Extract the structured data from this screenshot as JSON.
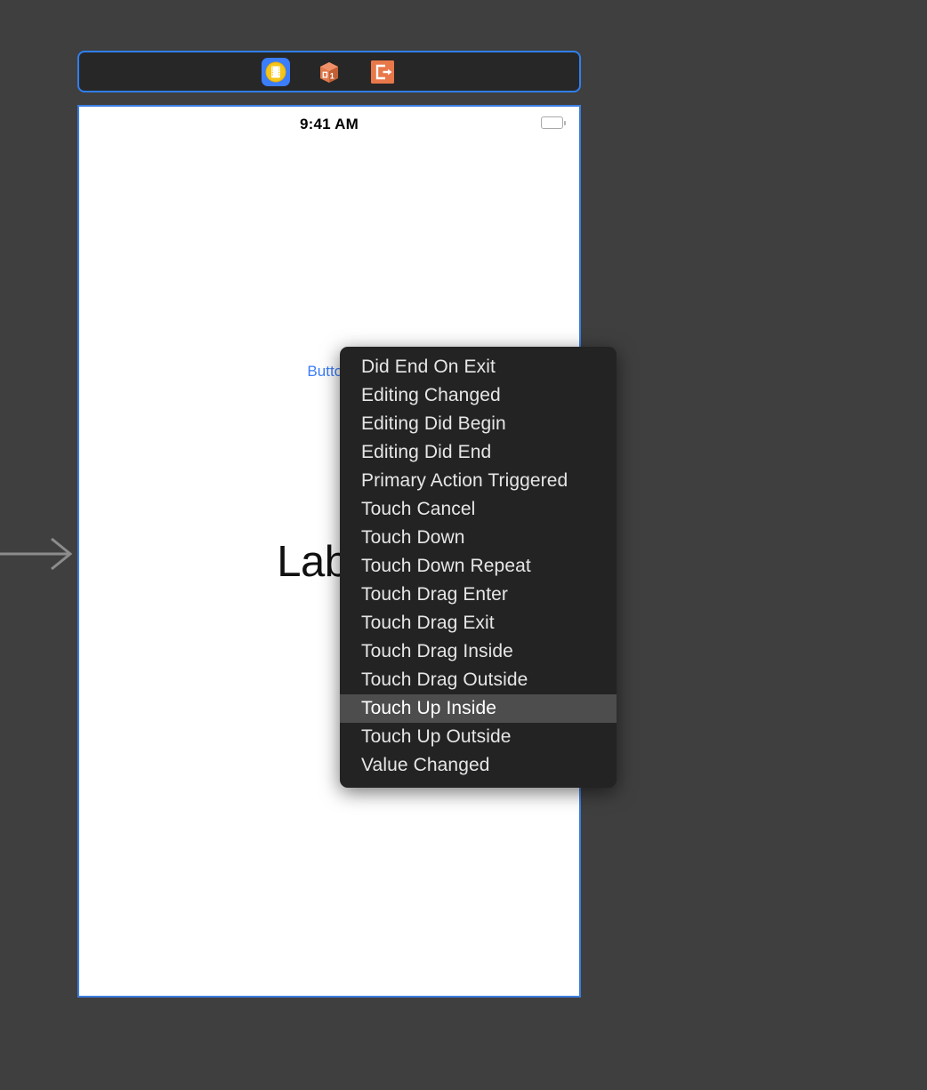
{
  "canvas_background_color": "#3f3f3f",
  "scene_dock": {
    "name": "scene-dock",
    "selected": true,
    "border_color": "#2f7ff0",
    "background_color": "#272727",
    "icons": [
      {
        "name": "view-controller-icon",
        "label": "View Controller",
        "selected": true,
        "colors": {
          "badge": "#3c7dfa",
          "inner": "#f5c518",
          "glyph": "#ffffff"
        }
      },
      {
        "name": "first-responder-icon",
        "label": "First Responder",
        "selected": false,
        "colors": {
          "cube": "#e8784a",
          "glyph": "#ffffff"
        }
      },
      {
        "name": "exit-icon",
        "label": "Exit",
        "selected": false,
        "colors": {
          "badge": "#e8784a",
          "glyph": "#ffffff"
        }
      }
    ]
  },
  "device": {
    "name": "device-canvas",
    "border_color": "#3b7de0",
    "background_color": "#ffffff",
    "status_bar": {
      "time": "9:41 AM",
      "battery_icon": "battery-full-icon"
    },
    "views": [
      {
        "name": "button",
        "text": "Button",
        "color": "#3c7dfa"
      },
      {
        "name": "label",
        "text": "Label",
        "color": "#111111"
      }
    ]
  },
  "connection_arrow": {
    "name": "connection-drag-arrow",
    "direction": "right",
    "color": "#8c8c8c"
  },
  "events_menu": {
    "name": "events-context-menu",
    "background_color": "#232323",
    "text_color": "#e6e6e6",
    "highlight_color": "#4d4d4d",
    "selected_index": 12,
    "items": [
      {
        "label": "Did End On Exit",
        "selected": false
      },
      {
        "label": "Editing Changed",
        "selected": false
      },
      {
        "label": "Editing Did Begin",
        "selected": false
      },
      {
        "label": "Editing Did End",
        "selected": false
      },
      {
        "label": "Primary Action Triggered",
        "selected": false
      },
      {
        "label": "Touch Cancel",
        "selected": false
      },
      {
        "label": "Touch Down",
        "selected": false
      },
      {
        "label": "Touch Down Repeat",
        "selected": false
      },
      {
        "label": "Touch Drag Enter",
        "selected": false
      },
      {
        "label": "Touch Drag Exit",
        "selected": false
      },
      {
        "label": "Touch Drag Inside",
        "selected": false
      },
      {
        "label": "Touch Drag Outside",
        "selected": false
      },
      {
        "label": "Touch Up Inside",
        "selected": true
      },
      {
        "label": "Touch Up Outside",
        "selected": false
      },
      {
        "label": "Value Changed",
        "selected": false
      }
    ]
  }
}
